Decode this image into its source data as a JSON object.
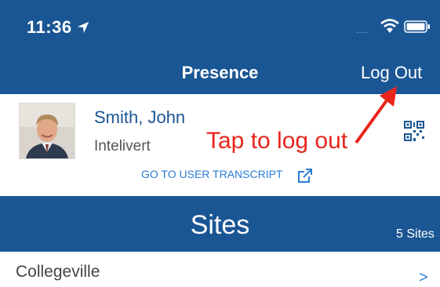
{
  "status_bar": {
    "time": "11:36",
    "signal_dots": "....",
    "icons": [
      "location-arrow-icon",
      "wifi-icon",
      "battery-icon"
    ]
  },
  "nav": {
    "title": "Presence",
    "logout_label": "Log Out"
  },
  "user": {
    "name": "Smith, John",
    "organization": "Intelivert",
    "transcript_link": "GO TO USER TRANSCRIPT"
  },
  "annotation": {
    "text": "Tap to log out",
    "color": "#e8251c"
  },
  "sites": {
    "title": "Sites",
    "count_label": "5 Sites",
    "items": [
      {
        "label": "Collegeville",
        "chevron": ">"
      }
    ]
  },
  "colors": {
    "brand": "#1b5694",
    "link": "#2a7dd6"
  }
}
